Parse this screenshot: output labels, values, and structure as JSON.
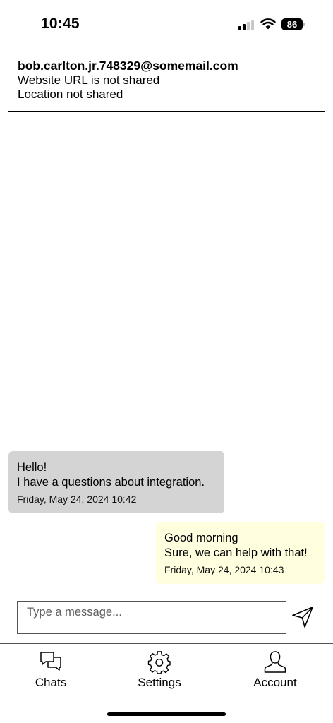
{
  "status_bar": {
    "time": "10:45",
    "battery": "86",
    "signal_bars_active": 2,
    "signal_bars_total": 4
  },
  "contact": {
    "email": "bob.carlton.jr.748329@somemail.com",
    "website": "Website URL is not shared",
    "location": "Location not shared"
  },
  "messages": [
    {
      "direction": "incoming",
      "lines": [
        "Hello!",
        "I have a questions about integration."
      ],
      "timestamp": "Friday, May 24, 2024 10:42",
      "color": "#d4d4d4"
    },
    {
      "direction": "outgoing",
      "lines": [
        "Good morning",
        "Sure, we can help with that!"
      ],
      "timestamp": "Friday, May 24, 2024 10:43",
      "color": "#ffffe0"
    }
  ],
  "composer": {
    "placeholder": "Type a message...",
    "value": "",
    "send_icon": "send-icon"
  },
  "tabs": [
    {
      "label": "Chats",
      "icon": "chat-bubbles-icon"
    },
    {
      "label": "Settings",
      "icon": "gear-icon"
    },
    {
      "label": "Account",
      "icon": "person-icon"
    }
  ]
}
